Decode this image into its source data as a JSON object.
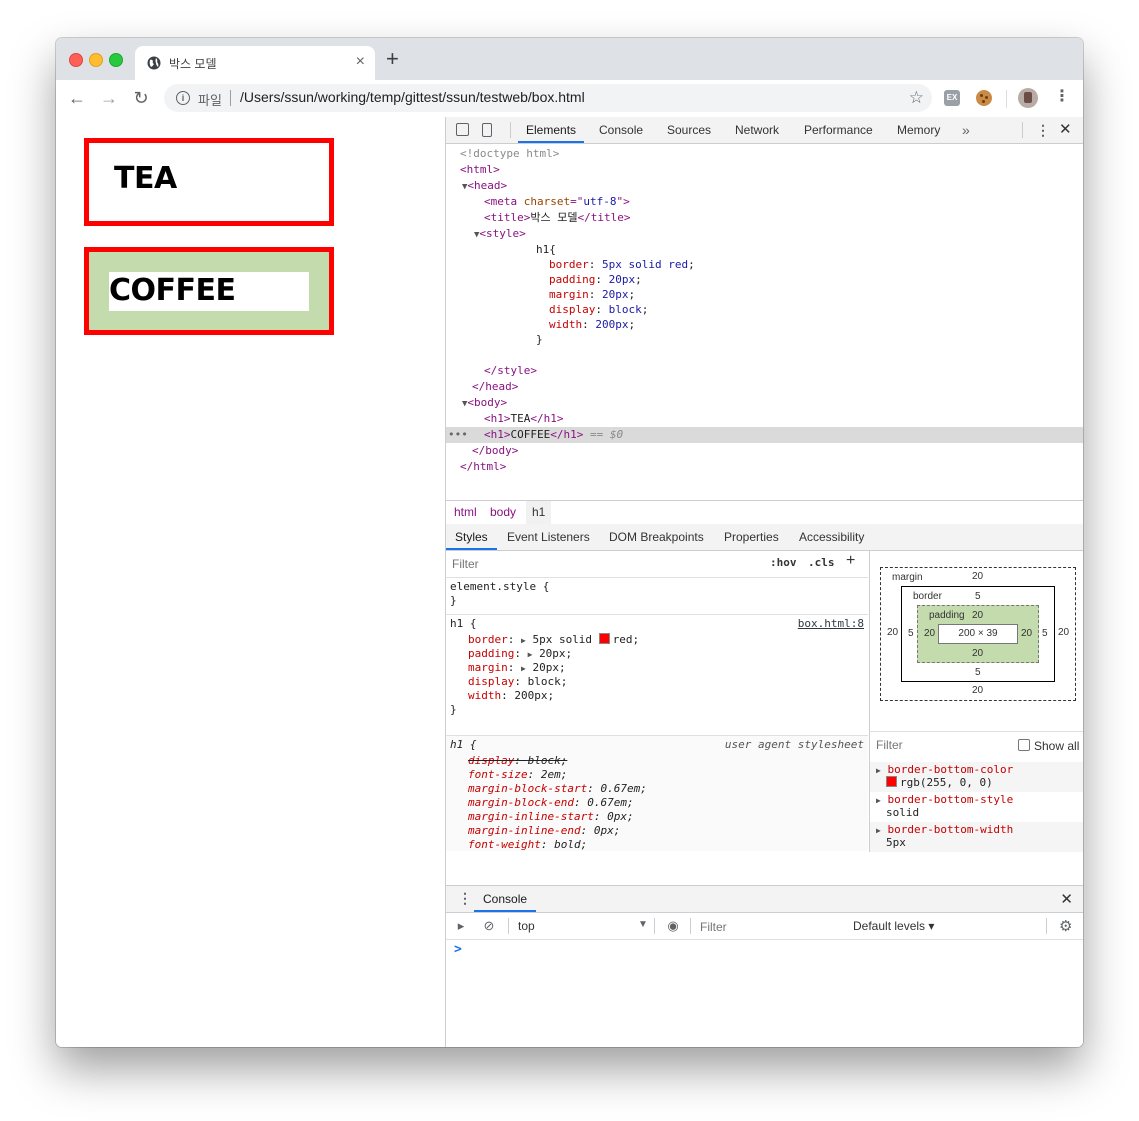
{
  "browser": {
    "tab_title": "박스 모델",
    "new_tab_glyph": "+",
    "scheme_label": "파일",
    "url": "/Users/ssun/working/temp/gittest/ssun/testweb/box.html",
    "ext_label": "EX"
  },
  "page": {
    "headings": [
      "TEA",
      "COFFEE"
    ]
  },
  "devtools": {
    "tabs": [
      "Elements",
      "Console",
      "Sources",
      "Network",
      "Performance",
      "Memory"
    ],
    "more": "»",
    "dom": {
      "doctype": "<!doctype html>",
      "html_open": "<html>",
      "head_open": "<head>",
      "meta": {
        "tag_open": "<meta ",
        "attr": "charset",
        "eq": "=\"",
        "value": "utf-8",
        "tag_close": "\">"
      },
      "title": {
        "open": "<title>",
        "text": "박스 모델",
        "close": "</title>"
      },
      "style_open": "<style>",
      "css_selector": "h1{",
      "css_decls": [
        {
          "prop": "border",
          "value": "5px solid red"
        },
        {
          "prop": "padding",
          "value": "20px"
        },
        {
          "prop": "margin",
          "value": "20px"
        },
        {
          "prop": "display",
          "value": "block"
        },
        {
          "prop": "width",
          "value": "200px"
        }
      ],
      "css_close": "}",
      "style_close": "</style>",
      "head_close": "</head>",
      "body_open": "<body>",
      "h1_tea": {
        "open": "<h1>",
        "text": "TEA",
        "close": "</h1>"
      },
      "h1_coffee": {
        "open": "<h1>",
        "text": "COFFEE",
        "close": "</h1>",
        "marker": "== $0"
      },
      "body_close": "</body>",
      "html_close": "</html>",
      "dots": "•••"
    },
    "breadcrumbs": [
      "html",
      "body",
      "h1"
    ],
    "subtabs": [
      "Styles",
      "Event Listeners",
      "DOM Breakpoints",
      "Properties",
      "Accessibility"
    ],
    "styles": {
      "filter_placeholder": "Filter",
      "hov": ":hov",
      "cls": ".cls",
      "plus": "+",
      "element_style_open": "element.style {",
      "close_brace": "}",
      "rule1": {
        "selector": "h1 {",
        "source": "box.html:8",
        "decls": [
          {
            "prop": "border",
            "value": "5px solid ",
            "tail": "red;"
          },
          {
            "prop": "padding",
            "value": "20px;"
          },
          {
            "prop": "margin",
            "value": "20px;"
          },
          {
            "prop": "display",
            "value": "block;"
          },
          {
            "prop": "width",
            "value": "200px;"
          }
        ]
      },
      "rule2": {
        "selector": "h1 {",
        "source": "user agent stylesheet",
        "decls": [
          {
            "prop": "display",
            "value": "block;"
          },
          {
            "prop": "font-size",
            "value": "2em;"
          },
          {
            "prop": "margin-block-start",
            "value": "0.67em;"
          },
          {
            "prop": "margin-block-end",
            "value": "0.67em;"
          },
          {
            "prop": "margin-inline-start",
            "value": "0px;"
          },
          {
            "prop": "margin-inline-end",
            "value": "0px;"
          },
          {
            "prop": "font-weight",
            "value": "bold;"
          }
        ]
      },
      "swatch_color": "#ff0000"
    },
    "box_model": {
      "margin_label": "margin",
      "border_label": "border",
      "padding_label": "padding",
      "margin_top": "20",
      "margin_right": "20",
      "margin_bottom": "20",
      "margin_left": "20",
      "border_top": "5",
      "border_right": "5",
      "border_bottom": "5",
      "border_left": "5",
      "padding_top": "20",
      "padding_right": "20",
      "padding_bottom": "20",
      "padding_left": "20",
      "content": "200 × 39",
      "padding_color": "#c3dbad"
    },
    "computed": {
      "filter_placeholder": "Filter",
      "show_all": "Show all",
      "items": [
        {
          "name": "border-bottom-color",
          "value": "rgb(255, 0, 0)"
        },
        {
          "name": "border-bottom-style",
          "value": "solid"
        },
        {
          "name": "border-bottom-width",
          "value": "5px"
        }
      ]
    },
    "drawer": {
      "tab": "Console",
      "context": "top",
      "filter_placeholder": "Filter",
      "levels": "Default levels ▾",
      "prompt": ">"
    }
  }
}
